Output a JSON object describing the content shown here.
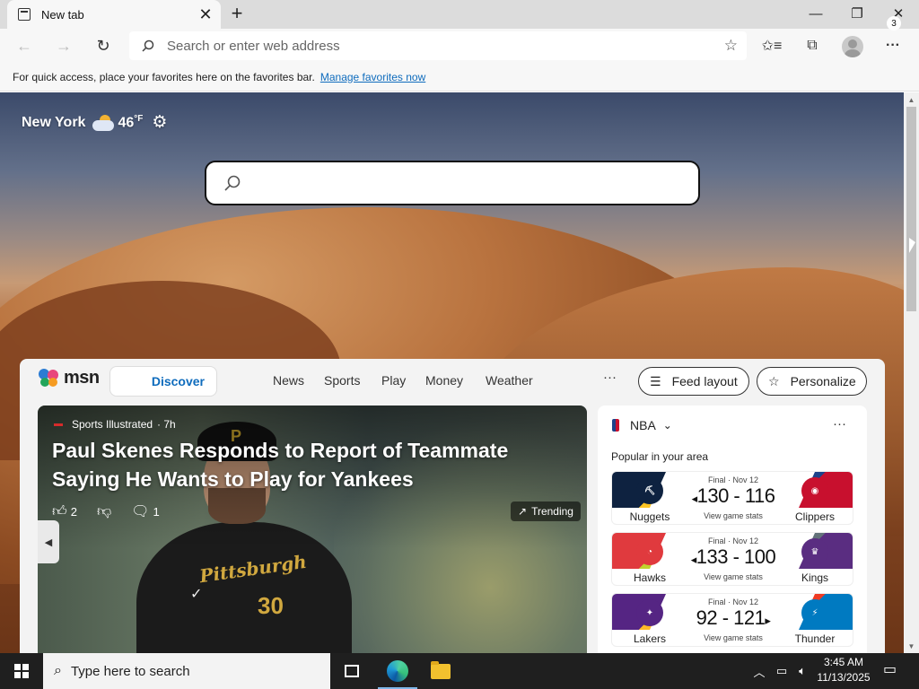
{
  "browser": {
    "tab_title": "New tab",
    "tab_close": "✕",
    "new_tab": "+",
    "minimize": "—",
    "maximize": "❐",
    "close": "✕"
  },
  "toolbar": {
    "back": "←",
    "forward": "→",
    "refresh": "↻",
    "address_placeholder": "Search or enter web address",
    "favorite_star": "☆",
    "favorites": "✩≡",
    "collections": "⧉",
    "more": "···"
  },
  "favbar": {
    "text": "For quick access, place your favorites here on the favorites bar.",
    "link": "Manage favorites now"
  },
  "weather": {
    "city": "New York",
    "temp": "46",
    "unit": "°F",
    "settings": "⚙"
  },
  "msn": {
    "logo": "msn",
    "discover": "Discover",
    "nav": [
      "News",
      "Sports",
      "Play",
      "Money",
      "Weather"
    ],
    "more": "···",
    "feed_layout": "Feed layout",
    "personalize": "Personalize"
  },
  "hero": {
    "source": "Sports Illustrated",
    "age": "· 7h",
    "headline": "Paul Skenes Responds to Report of Teammate Saying He Wants to Play for Yankees",
    "likes": "2",
    "comments": "1",
    "trending": "Trending",
    "jersey_text": "Pittsburgh",
    "jersey_number": "30",
    "cap_letter": "P"
  },
  "nba": {
    "league": "NBA",
    "more": "···",
    "popular": "Popular in your area",
    "games": [
      {
        "status": "Final · Nov 12",
        "score": "130 - 116",
        "winner_arrow": "◂",
        "arrow_side": "left",
        "stats": "View game stats",
        "home": "Nuggets",
        "away": "Clippers",
        "home_color": "#0e2240",
        "home_accent": "#fec524",
        "away_color": "#c8102e",
        "away_accent": "#1d428a"
      },
      {
        "status": "Final · Nov 12",
        "score": "133 - 100",
        "winner_arrow": "◂",
        "arrow_side": "left",
        "stats": "View game stats",
        "home": "Hawks",
        "away": "Kings",
        "home_color": "#e03a3e",
        "home_accent": "#c1d32f",
        "away_color": "#5a2d81",
        "away_accent": "#63727a"
      },
      {
        "status": "Final · Nov 12",
        "score": "92 - 121",
        "winner_arrow": "▸",
        "arrow_side": "right",
        "stats": "View game stats",
        "home": "Lakers",
        "away": "Thunder",
        "home_color": "#552583",
        "home_accent": "#fdb927",
        "away_color": "#007ac1",
        "away_accent": "#ef3b24"
      }
    ]
  },
  "taskbar": {
    "search_placeholder": "Type here to search",
    "time": "3:45 AM",
    "date": "11/13/2025",
    "notifications": "3"
  }
}
